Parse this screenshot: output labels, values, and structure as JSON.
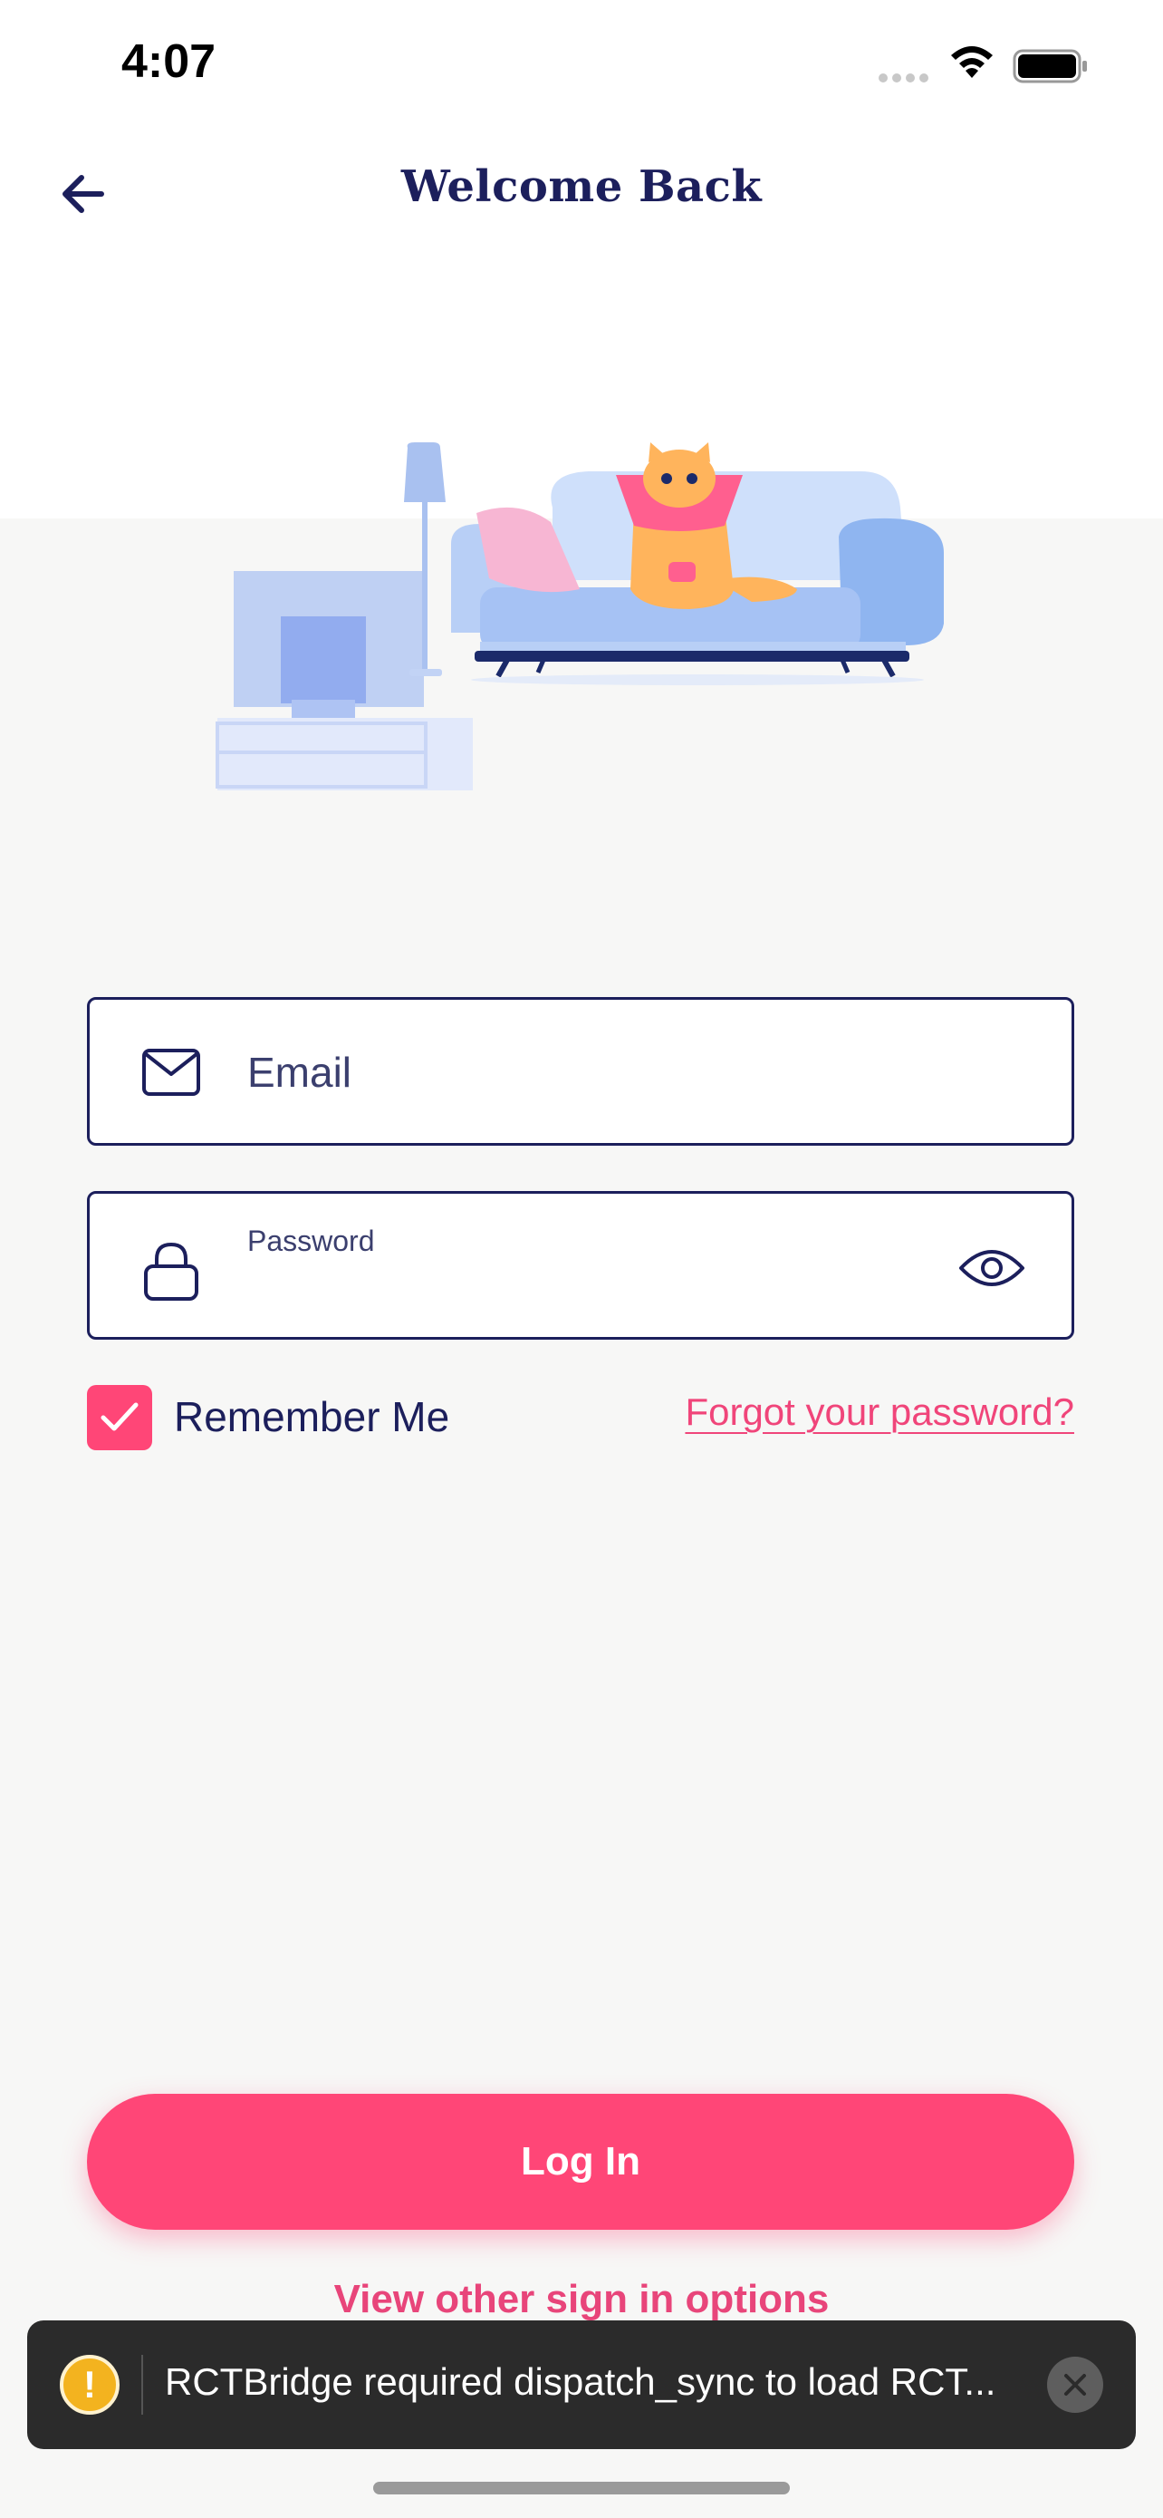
{
  "status_bar": {
    "time": "4:07",
    "icons": [
      "signal-dots-icon",
      "wifi-icon",
      "battery-icon"
    ]
  },
  "header": {
    "title": "Welcome Back",
    "back_icon": "arrow-left-icon"
  },
  "hero": {
    "illustration": "cat-on-sofa-living-room"
  },
  "form": {
    "email": {
      "placeholder": "Email",
      "value": "",
      "icon": "envelope-icon"
    },
    "password": {
      "label": "Password",
      "value": "",
      "icon": "lock-icon",
      "toggle_icon": "eye-icon"
    },
    "remember_me": {
      "label": "Remember Me",
      "checked": true
    },
    "forgot_password": "Forgot your password?"
  },
  "actions": {
    "login_label": "Log In",
    "other_options_label": "View other sign in options"
  },
  "toast": {
    "text": "RCTBridge required dispatch_sync to load RCT...",
    "icon": "warning-icon",
    "close_icon": "close-icon"
  },
  "colors": {
    "primary": "#ff4677",
    "navy": "#1c1f5c",
    "background": "#f7f7f6",
    "toast_bg": "#2b2b2b",
    "warning": "#f3b31f"
  }
}
